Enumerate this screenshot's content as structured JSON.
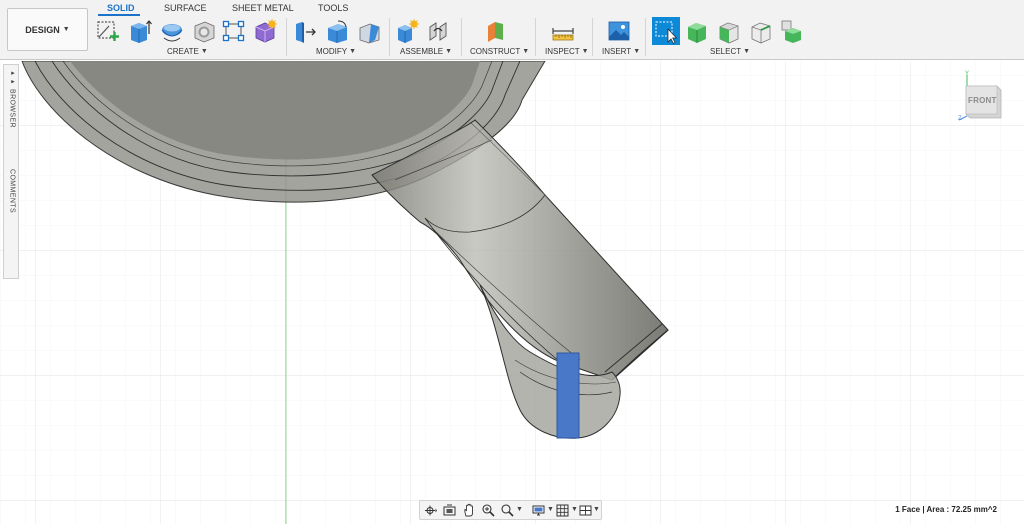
{
  "workspace": {
    "label": "DESIGN"
  },
  "tabs": [
    {
      "label": "SOLID",
      "active": true
    },
    {
      "label": "SURFACE",
      "active": false
    },
    {
      "label": "SHEET METAL",
      "active": false
    },
    {
      "label": "TOOLS",
      "active": false
    }
  ],
  "groups": {
    "create": "CREATE",
    "modify": "MODIFY",
    "assemble": "ASSEMBLE",
    "construct": "CONSTRUCT",
    "inspect": "INSPECT",
    "insert": "INSERT",
    "select": "SELECT"
  },
  "tools": {
    "create": [
      "create-sketch-icon",
      "extrude-icon",
      "revolve-icon",
      "shell-icon",
      "sketch-rectangle-icon",
      "form-icon"
    ],
    "modify": [
      "press-pull-icon",
      "fillet-icon",
      "chamfer-icon"
    ],
    "assemble": [
      "new-component-icon",
      "joint-icon"
    ],
    "construct": [
      "offset-plane-icon"
    ],
    "inspect": [
      "measure-icon"
    ],
    "insert": [
      "insert-image-icon"
    ],
    "select": [
      "window-select-icon",
      "select-body-icon",
      "select-face-icon",
      "select-edge-icon",
      "select-component-icon"
    ]
  },
  "side_panel": {
    "browser": "BROWSER",
    "comments": "COMMENTS"
  },
  "viewcube": {
    "face": "FRONT",
    "axis_y": "Y",
    "axis_z": "Z"
  },
  "status": {
    "text": "1 Face | Area : 72.25 mm^2"
  },
  "colors": {
    "accent": "#1a73c9",
    "model_gray": "#8d8d86",
    "selected_face": "#4a78c8",
    "grid": "#e8e8e8",
    "axis_green": "#8bcf8b"
  }
}
